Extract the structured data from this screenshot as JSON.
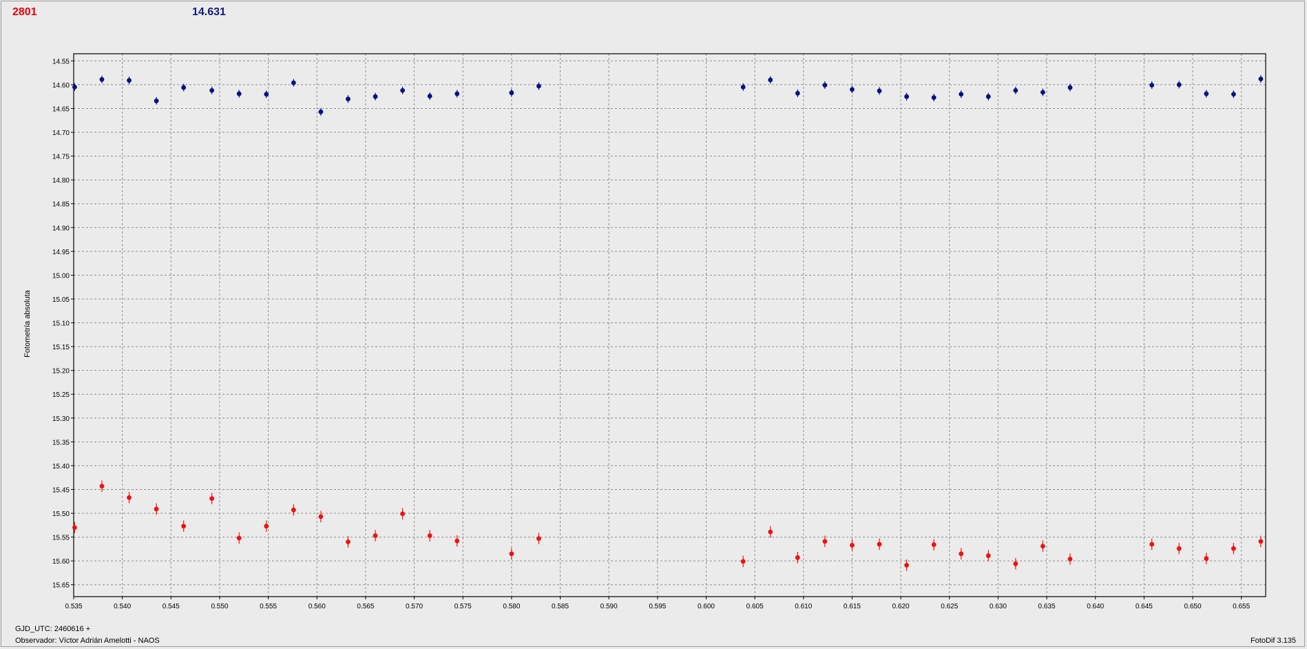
{
  "header": {
    "red_value": "2801",
    "blue_value": "14.631"
  },
  "colors": {
    "series_blue": "#0a0f82",
    "series_red": "#f01010",
    "grid": "#8c8c8c",
    "plot_bg": "#ebebeb"
  },
  "footer": {
    "gjd": "GJD_UTC: 2460616 +",
    "observer": "Observador: Víctor Adrián Amelotti - NAOS",
    "version": "FotoDif 3.135"
  },
  "chart_data": {
    "type": "scatter",
    "ylabel": "Fotometría absoluta",
    "xlim": [
      0.535,
      0.6575
    ],
    "ylim": [
      15.675,
      14.535
    ],
    "y_inverted": true,
    "grid": true,
    "x_ticks": [
      "0.535",
      "0.540",
      "0.545",
      "0.550",
      "0.555",
      "0.560",
      "0.565",
      "0.570",
      "0.575",
      "0.580",
      "0.585",
      "0.590",
      "0.595",
      "0.600",
      "0.605",
      "0.610",
      "0.615",
      "0.620",
      "0.625",
      "0.630",
      "0.635",
      "0.640",
      "0.645",
      "0.650",
      "0.655"
    ],
    "y_ticks": [
      "14.55",
      "14.60",
      "14.65",
      "14.70",
      "14.75",
      "14.80",
      "14.85",
      "14.90",
      "14.95",
      "15.00",
      "15.05",
      "15.10",
      "15.15",
      "15.20",
      "15.25",
      "15.30",
      "15.35",
      "15.40",
      "15.45",
      "15.50",
      "15.55",
      "15.60",
      "15.65"
    ],
    "x": [
      0.5351,
      0.5379,
      0.5407,
      0.5435,
      0.5463,
      0.5492,
      0.552,
      0.5548,
      0.5576,
      0.5604,
      0.5632,
      0.566,
      0.5688,
      0.5716,
      0.5744,
      0.58,
      0.5828,
      0.6038,
      0.6066,
      0.6094,
      0.6122,
      0.615,
      0.6178,
      0.6206,
      0.6234,
      0.6262,
      0.629,
      0.6318,
      0.6346,
      0.6374,
      0.6458,
      0.6486,
      0.6514,
      0.6542,
      0.657
    ],
    "series": [
      {
        "color": "#0a0f82",
        "error": 0.008,
        "values": [
          14.605,
          14.589,
          14.591,
          14.634,
          14.606,
          14.612,
          14.619,
          14.62,
          14.596,
          14.657,
          14.63,
          14.625,
          14.612,
          14.624,
          14.619,
          14.617,
          14.603,
          14.605,
          14.59,
          14.618,
          14.601,
          14.61,
          14.613,
          14.625,
          14.627,
          14.62,
          14.625,
          14.612,
          14.616,
          14.606,
          14.601,
          14.6,
          14.619,
          14.62,
          14.588
        ]
      },
      {
        "color": "#f01010",
        "error": 0.012,
        "values": [
          15.53,
          15.443,
          15.467,
          15.491,
          15.527,
          15.469,
          15.552,
          15.527,
          15.493,
          15.507,
          15.56,
          15.547,
          15.501,
          15.547,
          15.558,
          15.585,
          15.553,
          15.601,
          15.539,
          15.593,
          15.559,
          15.567,
          15.565,
          15.609,
          15.566,
          15.585,
          15.589,
          15.606,
          15.569,
          15.596,
          15.565,
          15.574,
          15.595,
          15.574,
          15.559
        ]
      }
    ]
  }
}
